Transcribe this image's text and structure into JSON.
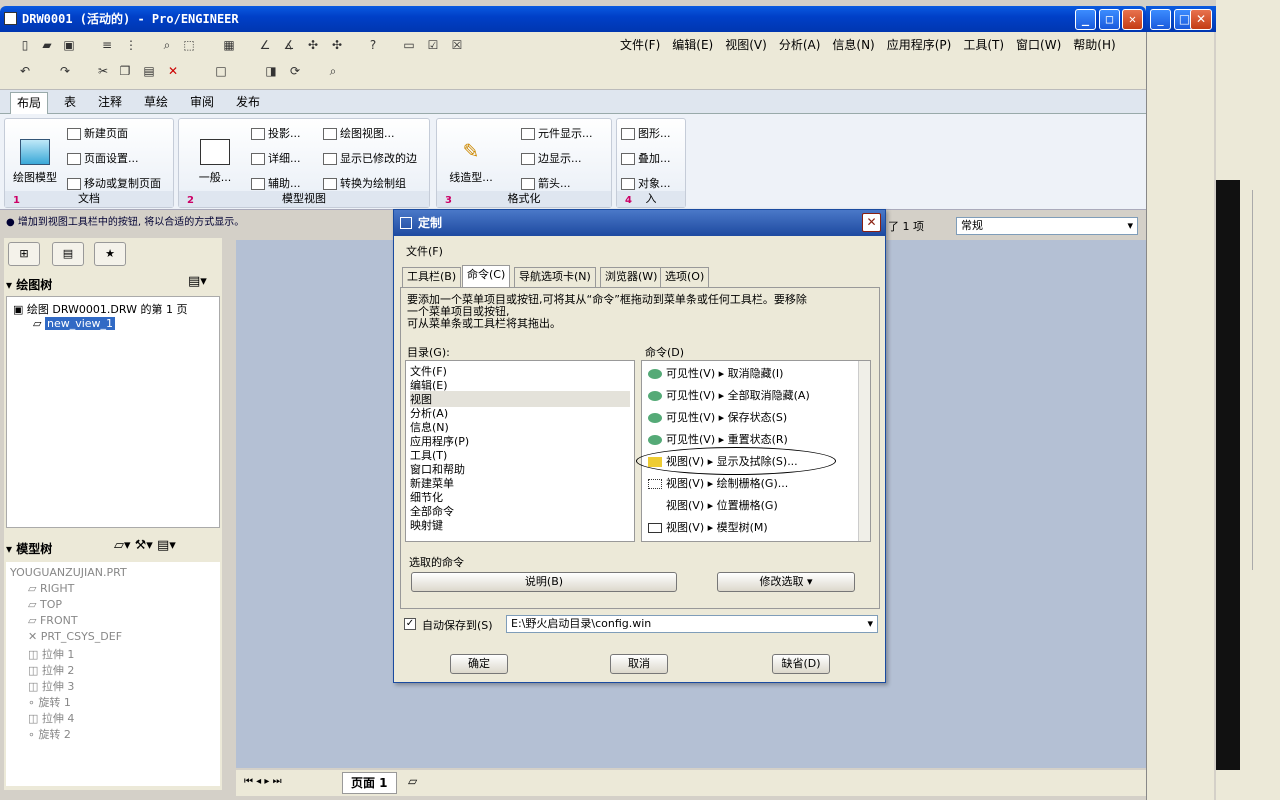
{
  "window": {
    "title": "DRW0001 (活动的) - Pro/ENGINEER"
  },
  "menu": [
    "文件(F)",
    "编辑(E)",
    "视图(V)",
    "分析(A)",
    "信息(N)",
    "应用程序(P)",
    "工具(T)",
    "窗口(W)",
    "帮助(H)"
  ],
  "ribbon_tabs": [
    "布局",
    "表",
    "注释",
    "草绘",
    "审阅",
    "发布"
  ],
  "groups": {
    "doc": {
      "title": "文档",
      "num": "1",
      "big": "绘图模型",
      "items": [
        "新建页面",
        "页面设置...",
        "移动或复制页面"
      ]
    },
    "model": {
      "title": "模型视图",
      "num": "2",
      "big": "一般...",
      "items": [
        "投影...",
        "详细...",
        "辅助...",
        "绘图视图...",
        "显示已修改的边",
        "转换为绘制组"
      ]
    },
    "format": {
      "title": "格式化",
      "num": "3",
      "big": "线造型...",
      "items": [
        "元件显示...",
        "边显示...",
        "箭头..."
      ]
    },
    "insert": {
      "title": "入",
      "num": "4",
      "items": [
        "图形...",
        "叠加...",
        "对象..."
      ]
    }
  },
  "status": "● 增加到视图工具栏中的按钮, 将以合适的方式显示。",
  "status_right": {
    "selected": "了 1 项",
    "filter": "常规"
  },
  "nav": {
    "drawing_tree_label": "绘图树",
    "drawing_tree": [
      "绘图 DRW0001.DRW 的第 1 页",
      "new_view_1"
    ],
    "model_tree_label": "模型树",
    "model_tree": [
      "YOUGUANZUJIAN.PRT",
      "RIGHT",
      "TOP",
      "FRONT",
      "PRT_CSYS_DEF",
      "拉伸 1",
      "拉伸 2",
      "拉伸 3",
      "旋转 1",
      "拉伸 4",
      "旋转 2"
    ]
  },
  "bottom": {
    "page": "页面 1"
  },
  "dialog": {
    "title": "定制",
    "menu": "文件(F)",
    "tabs": [
      "工具栏(B)",
      "命令(C)",
      "导航选项卡(N)",
      "浏览器(W)",
      "选项(O)"
    ],
    "desc1": "要添加一个菜单项目或按钮,可将其从“命令”框拖动到菜单条或任何工具栏。要移除",
    "desc2": "一个菜单项目或按钮,",
    "desc3": "可从菜单条或工具栏将其拖出。",
    "catalog_label": "目录(G):",
    "catalog": [
      "文件(F)",
      "编辑(E)",
      "视图",
      "分析(A)",
      "信息(N)",
      "应用程序(P)",
      "工具(T)",
      "窗口和帮助",
      "新建菜单",
      "细节化",
      "全部命令",
      "映射键"
    ],
    "commands_label": "命令(D)",
    "commands": [
      {
        "a": "可见性(V)",
        "b": "取消隐藏(I)"
      },
      {
        "a": "可见性(V)",
        "b": "全部取消隐藏(A)"
      },
      {
        "a": "可见性(V)",
        "b": "保存状态(S)"
      },
      {
        "a": "可见性(V)",
        "b": "重置状态(R)"
      },
      {
        "a": "视图(V)",
        "b": "显示及拭除(S)..."
      },
      {
        "a": "视图(V)",
        "b": "绘制栅格(G)..."
      },
      {
        "a": "视图(V)",
        "b": "位置栅格(G)"
      },
      {
        "a": "视图(V)",
        "b": "模型树(M)"
      }
    ],
    "selected_cmd_label": "选取的命令",
    "explain_btn": "说明(B)",
    "modify_btn": "修改选取",
    "autosave_label": "自动保存到(S)",
    "autosave_path": "E:\\野火启动目录\\config.win",
    "ok": "确定",
    "cancel": "取消",
    "default": "缺省(D)"
  }
}
